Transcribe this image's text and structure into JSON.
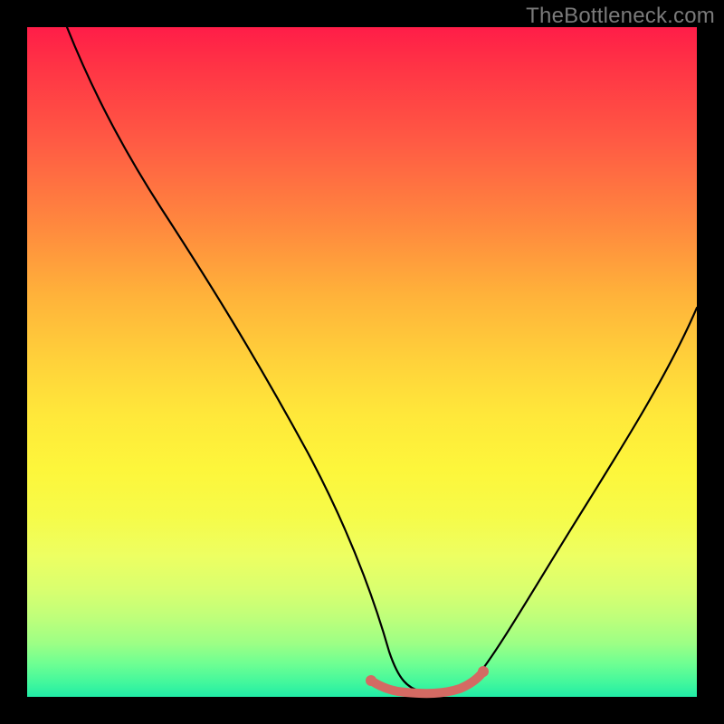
{
  "watermark": "TheBottleneck.com",
  "chart_data": {
    "type": "line",
    "title": "",
    "xlabel": "",
    "ylabel": "",
    "xlim": [
      0,
      100
    ],
    "ylim": [
      0,
      100
    ],
    "grid": false,
    "series": [
      {
        "name": "bottleneck-curve",
        "x": [
          6,
          12,
          20,
          28,
          36,
          44,
          50,
          53,
          56,
          60,
          64,
          70,
          78,
          86,
          94,
          100
        ],
        "values": [
          100,
          88,
          73,
          59,
          45,
          29,
          14,
          6,
          2,
          1,
          2,
          8,
          20,
          34,
          48,
          58
        ]
      }
    ],
    "valley_highlight": {
      "x_start": 50,
      "x_end": 68,
      "y_level": 2
    },
    "gradient_stops": [
      {
        "pos": 0.0,
        "color": "#ff1d48"
      },
      {
        "pos": 0.5,
        "color": "#ffd23a"
      },
      {
        "pos": 0.8,
        "color": "#edff62"
      },
      {
        "pos": 1.0,
        "color": "#21eca6"
      }
    ]
  }
}
